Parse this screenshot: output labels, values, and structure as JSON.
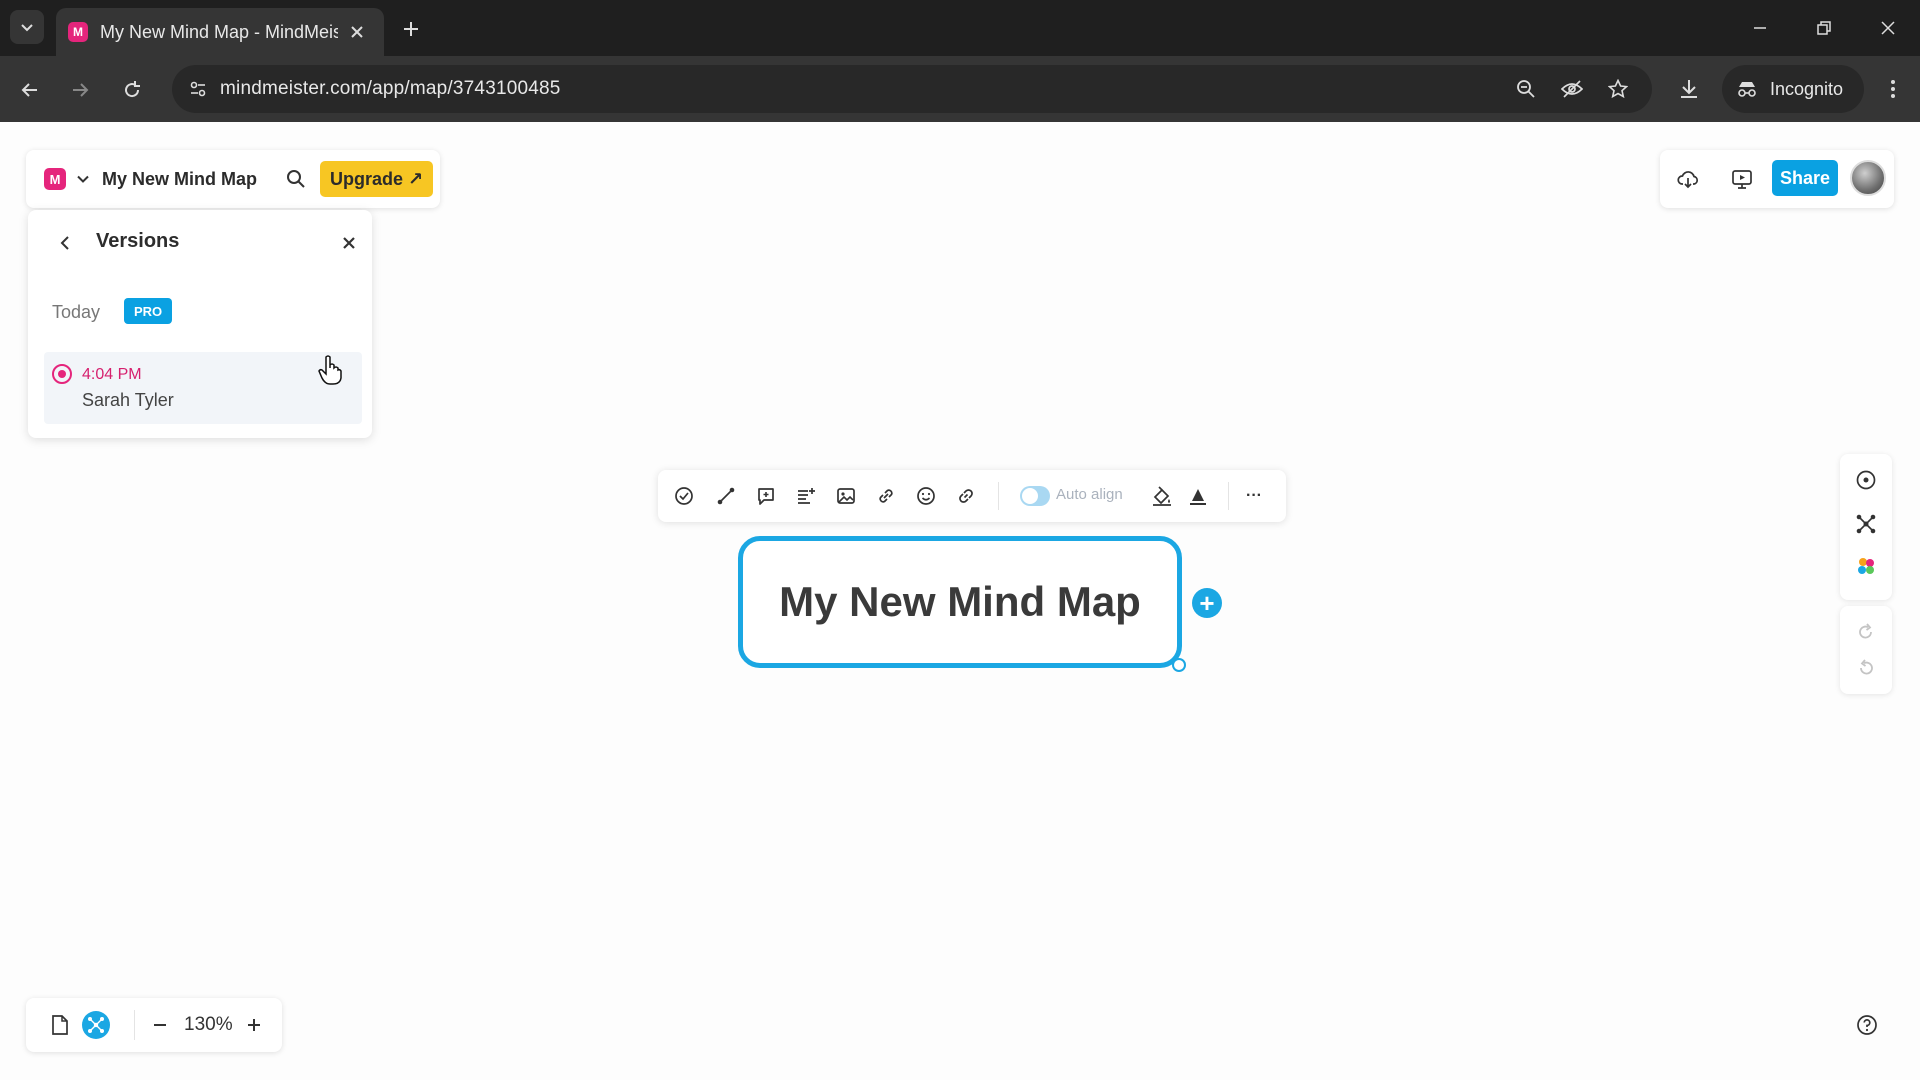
{
  "browser": {
    "tab_title": "My New Mind Map - MindMeister",
    "url": "mindmeister.com/app/map/3743100485",
    "incognito_label": "Incognito"
  },
  "app": {
    "brand_letter": "M",
    "map_title": "My New Mind Map",
    "upgrade_label": "Upgrade ↗",
    "share_label": "Share"
  },
  "versions": {
    "title": "Versions",
    "group_label": "Today",
    "pro_badge": "PRO",
    "entries": [
      {
        "time": "4:04 PM",
        "author": "Sarah Tyler"
      }
    ]
  },
  "node_toolbar": {
    "auto_align_label": "Auto align",
    "more_label": "···"
  },
  "canvas": {
    "root_node_text": "My New Mind Map",
    "add_child_label": "+"
  },
  "zoom": {
    "level": "130%"
  },
  "colors": {
    "brand_pink": "#e5257c",
    "accent_blue": "#1ba7e3",
    "upgrade_yellow": "#f7c623",
    "share_blue": "#0aa1e2"
  }
}
